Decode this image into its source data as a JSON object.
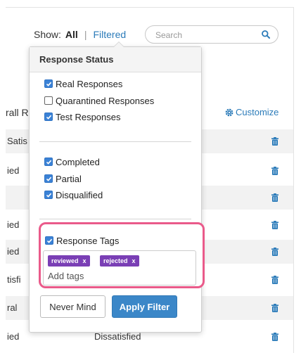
{
  "toolbar": {
    "show_label": "Show:",
    "show_all": "All",
    "separator": "|",
    "show_filtered": "Filtered",
    "search_placeholder": "Search"
  },
  "table": {
    "column_header_fragment": "rall R",
    "customize_label": "Customize",
    "rows": [
      {
        "fragment": "Satis"
      },
      {
        "fragment": "ied"
      },
      {
        "fragment": ""
      },
      {
        "fragment": "ied"
      },
      {
        "fragment": "ied"
      },
      {
        "fragment": "tisfi"
      },
      {
        "fragment": "ral"
      },
      {
        "fragment": "ied",
        "status": "Dissatisfied"
      }
    ]
  },
  "dropdown": {
    "header": "Response Status",
    "group1": [
      {
        "label": "Real Responses",
        "checked": true
      },
      {
        "label": "Quarantined Responses",
        "checked": false
      },
      {
        "label": "Test Responses",
        "checked": true
      }
    ],
    "group2": [
      {
        "label": "Completed",
        "checked": true
      },
      {
        "label": "Partial",
        "checked": true
      },
      {
        "label": "Disqualified",
        "checked": true
      }
    ],
    "tags": {
      "label": "Response Tags",
      "checked": true,
      "chips": [
        {
          "label": "reviewed",
          "remove": "x"
        },
        {
          "label": "rejected",
          "remove": "x"
        }
      ],
      "placeholder": "Add tags"
    },
    "buttons": {
      "cancel": "Never Mind",
      "apply": "Apply Filter"
    }
  },
  "colors": {
    "accent": "#2b7bb9",
    "checkbox": "#3b82d6",
    "tag": "#7a3fb5",
    "highlight": "#ea5a8a",
    "apply_button": "#3b87c8"
  }
}
